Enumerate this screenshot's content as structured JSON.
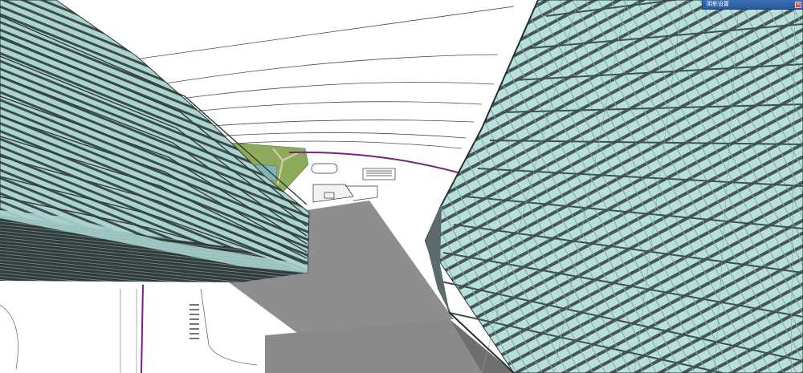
{
  "tray": {
    "title": "阴影设置",
    "close_symbol": "×"
  },
  "scene": {
    "description_icon": "3d-model-viewport",
    "colors": {
      "sky": "#ffffff",
      "glass": "#a8d5d1",
      "glass_light": "#c3e4df",
      "mullion": "#3b4a4a",
      "shadow": "#8c8c8c",
      "shadow_dark": "#6f6f6f",
      "lawn": "#8faa5c",
      "water": "#7fb0b2",
      "boundary": "#7b1f86",
      "tray_bg": "#3563ac"
    }
  }
}
